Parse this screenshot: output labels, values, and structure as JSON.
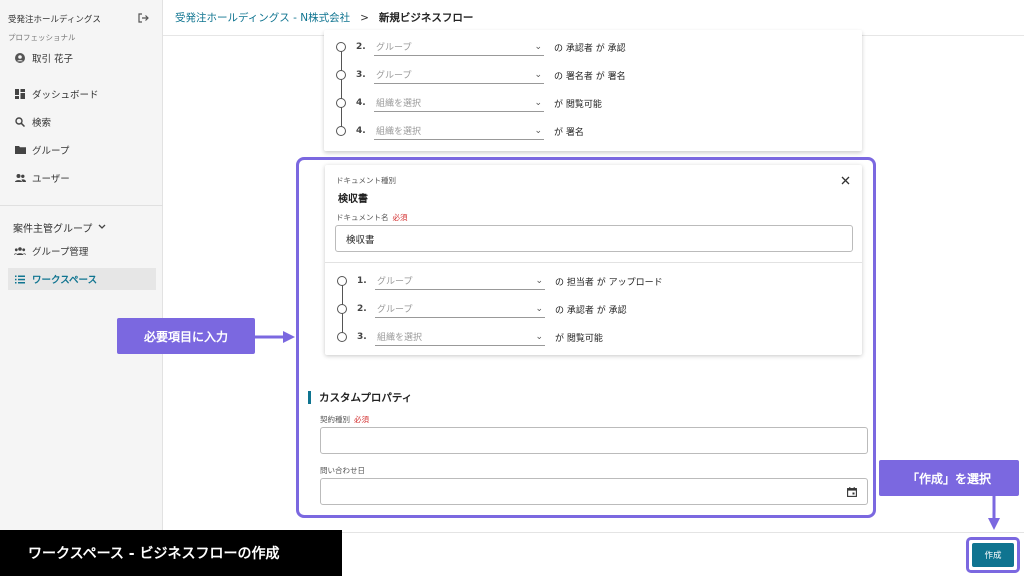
{
  "sidebar": {
    "org": "受発注ホールディングス",
    "plan": "プロフェッショナル",
    "user": "取引 花子",
    "nav": [
      {
        "label": "ダッシュボード",
        "icon": "dashboard-icon"
      },
      {
        "label": "検索",
        "icon": "search-icon"
      },
      {
        "label": "グループ",
        "icon": "folder-icon"
      },
      {
        "label": "ユーザー",
        "icon": "users-icon"
      }
    ],
    "group_header": "案件主管グループ",
    "group_items": [
      {
        "label": "グループ管理",
        "icon": "group-icon"
      },
      {
        "label": "ワークスペース",
        "icon": "list-icon"
      }
    ]
  },
  "header": {
    "crumb_link": "受発注ホールディングス - N株式会社",
    "crumb_sep": ">",
    "crumb_current": "新規ビジネスフロー"
  },
  "top_card": {
    "steps": [
      {
        "num": "2.",
        "placeholder": "グループ",
        "role": "の 承認者 が 承認"
      },
      {
        "num": "3.",
        "placeholder": "グループ",
        "role": "の 署名者 が 署名"
      },
      {
        "num": "4.",
        "placeholder": "組織を選択",
        "role": "が 閲覧可能"
      },
      {
        "num": "4.",
        "placeholder": "組織を選択",
        "role": "が 署名"
      }
    ]
  },
  "doc_card": {
    "type_label": "ドキュメント種別",
    "type_value": "検収書",
    "name_label": "ドキュメント名",
    "required": "必須",
    "name_value": "検収書",
    "steps": [
      {
        "num": "1.",
        "placeholder": "グループ",
        "role": "の 担当者 が アップロード"
      },
      {
        "num": "2.",
        "placeholder": "グループ",
        "role": "の 承認者 が 承認"
      },
      {
        "num": "3.",
        "placeholder": "組織を選択",
        "role": "が 閲覧可能"
      }
    ]
  },
  "custom": {
    "title": "カスタムプロパティ",
    "contract_label": "契約種別",
    "required": "必須",
    "contract_value": "",
    "inquiry_label": "問い合わせ日",
    "inquiry_value": ""
  },
  "callouts": {
    "input_required": "必要項目に入力",
    "select_create": "「作成」を選択"
  },
  "footer": {
    "caption": "ワークスペース - ビジネスフローの作成",
    "create_label": "作成"
  },
  "colors": {
    "accent": "#0f7490",
    "callout": "#7b68e0",
    "required": "#d32f2f"
  }
}
